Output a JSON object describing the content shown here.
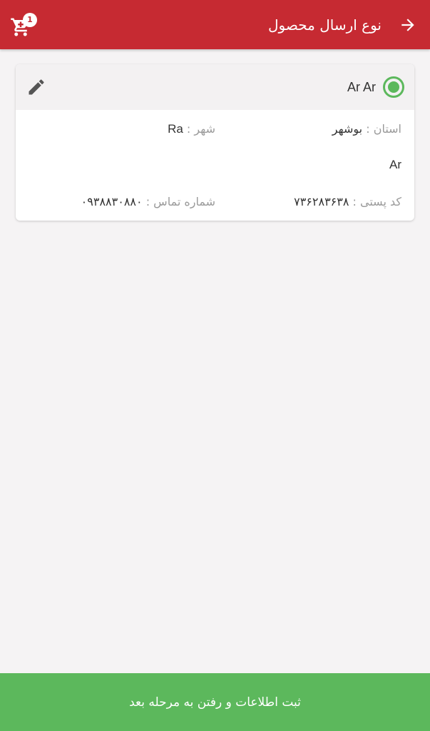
{
  "header": {
    "title": "نوع ارسال محصول",
    "cart_count": "1",
    "color": "#c62a32"
  },
  "address": {
    "name": "Ar Ar",
    "province_label": "استان :",
    "province_value": "بوشهر",
    "city_label": "شهر :",
    "city_value": "Ra",
    "address_line": "Ar",
    "postal_label": "کد پستی :",
    "postal_value": "۷۳۶۲۸۳۶۳۸",
    "phone_label": "شماره تماس :",
    "phone_value": "۰۹۳۸۸۳۰۸۸۰",
    "selected": true
  },
  "footer": {
    "submit_label": "ثبت اطلاعات و رفتن به مرحله بعد",
    "color": "#5cb85c"
  },
  "icons": [
    "cart-icon",
    "arrow-right-icon",
    "pencil-icon",
    "radio-selected-icon"
  ]
}
